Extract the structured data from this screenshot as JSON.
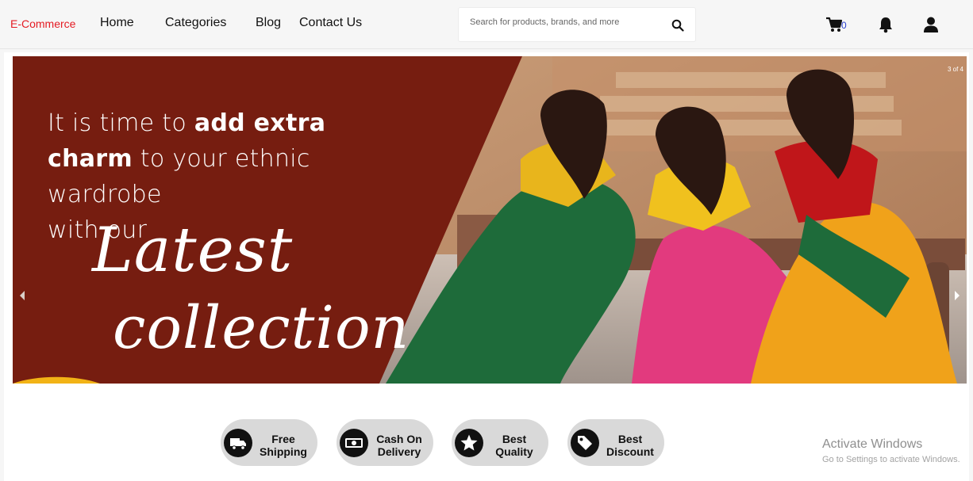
{
  "nav": {
    "brand": "E-Commerce",
    "links": [
      "Home",
      "Categories",
      "Blog",
      "Contact Us"
    ],
    "search_placeholder": "Search for products, brands, and more",
    "cart_count": "0"
  },
  "banner": {
    "line1_light": "It is time to ",
    "line1_bold": "add extra",
    "line2_bold": "charm",
    "line2_light": " to your ethnic",
    "line3": "wardrobe",
    "line4": "with our",
    "script1": "Latest",
    "script2": "collection",
    "slide_counter": "3 of 4",
    "bg_color": "#761d10"
  },
  "features": [
    {
      "line1": "Free",
      "line2": "Shipping",
      "icon": "truck-icon"
    },
    {
      "line1": "Cash On",
      "line2": "Delivery",
      "icon": "cash-icon"
    },
    {
      "line1": "Best",
      "line2": "Quality",
      "icon": "star-icon"
    },
    {
      "line1": "Best",
      "line2": "Discount",
      "icon": "tag-icon"
    }
  ],
  "watermark": {
    "title": "Activate Windows",
    "subtitle": "Go to Settings to activate Windows."
  }
}
